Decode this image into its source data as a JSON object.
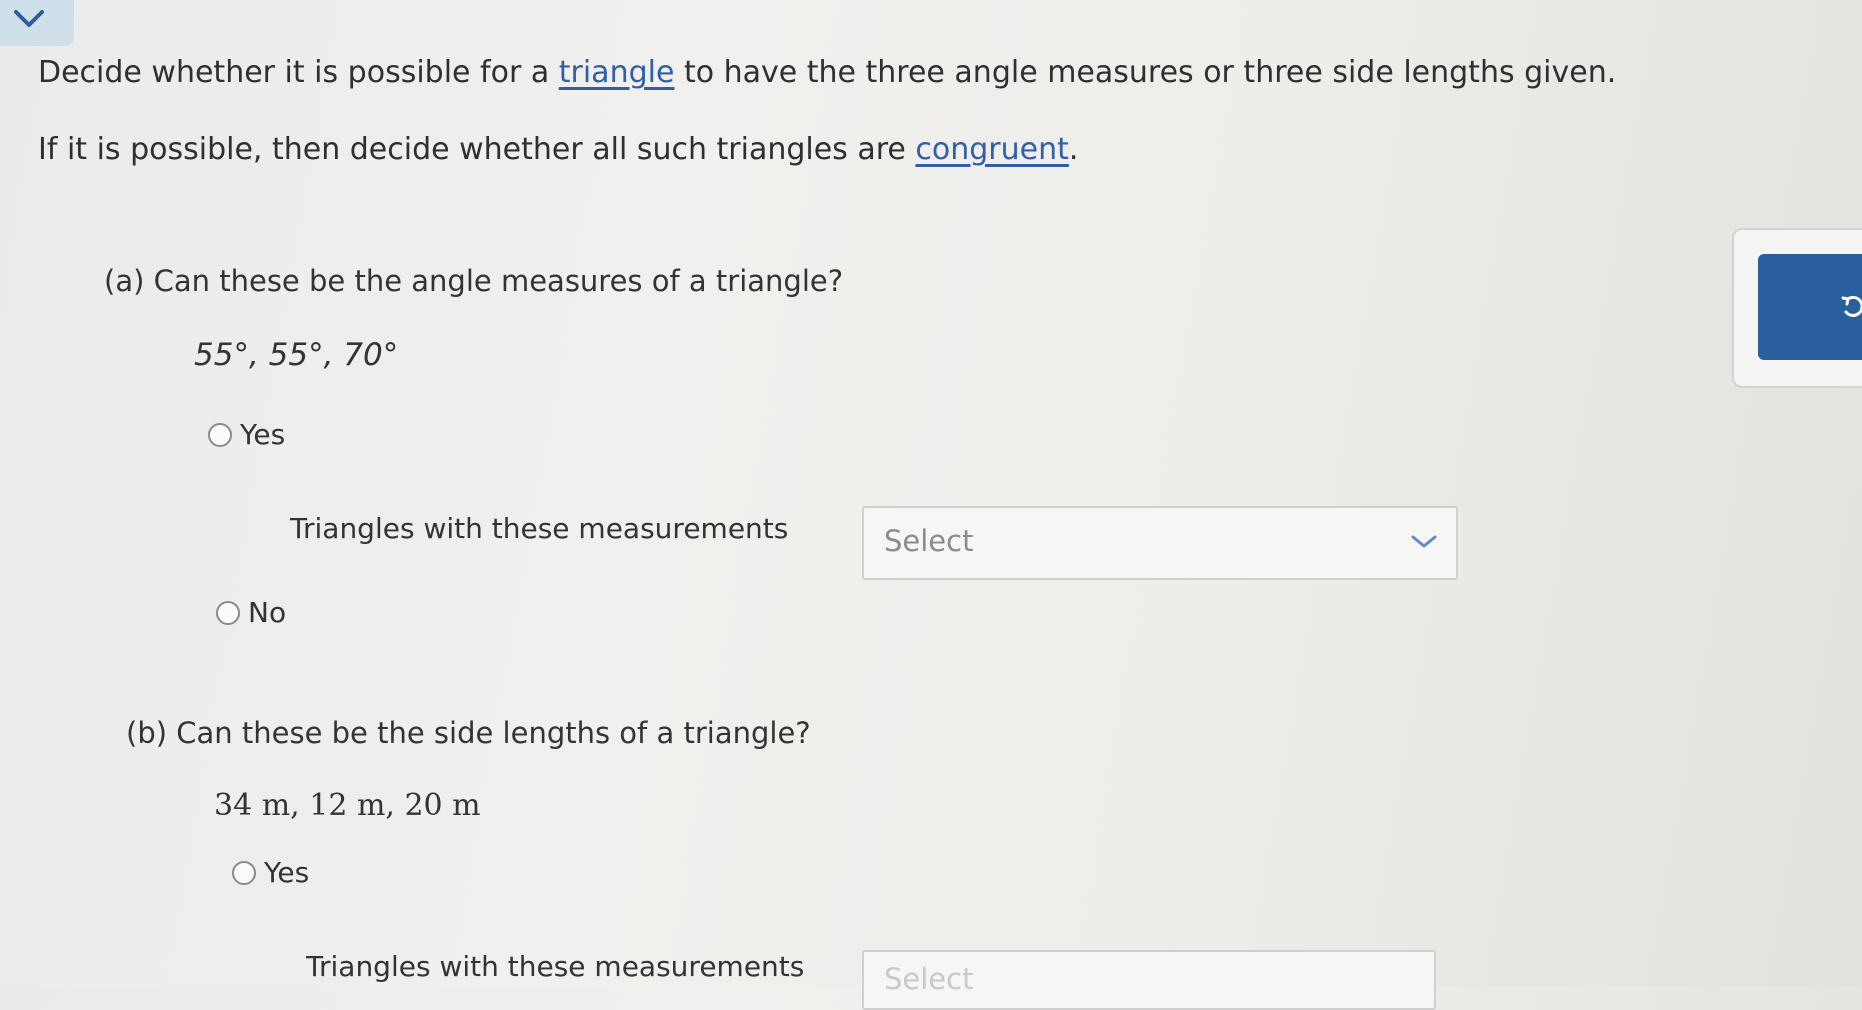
{
  "header": {
    "collapse_icon": "chevron-down-icon"
  },
  "intro": {
    "line1_before": "Decide whether it is possible for a ",
    "line1_link": "triangle",
    "line1_after": " to have the three angle measures or three side lengths given.",
    "line2_before": "If it is possible, then decide whether all such triangles are ",
    "line2_link": "congruent",
    "line2_after": "."
  },
  "side_panel": {
    "icon": "refresh-icon"
  },
  "part_a": {
    "question": "(a) Can these be the angle measures of a triangle?",
    "values": "55°, 55°, 70°",
    "option_yes": "Yes",
    "sub_label": "Triangles with these measurements",
    "select_value": "Select",
    "option_no": "No"
  },
  "part_b": {
    "question": "(b) Can these be the side lengths of a triangle?",
    "values": "34 m, 12 m, 20 m",
    "option_yes": "Yes",
    "sub_label": "Triangles with these measurements",
    "select_value": "Select"
  },
  "colors": {
    "link": "#2f5fa8",
    "side_button": "#2a5f9e",
    "collapse_tab": "#cfe0ea"
  }
}
